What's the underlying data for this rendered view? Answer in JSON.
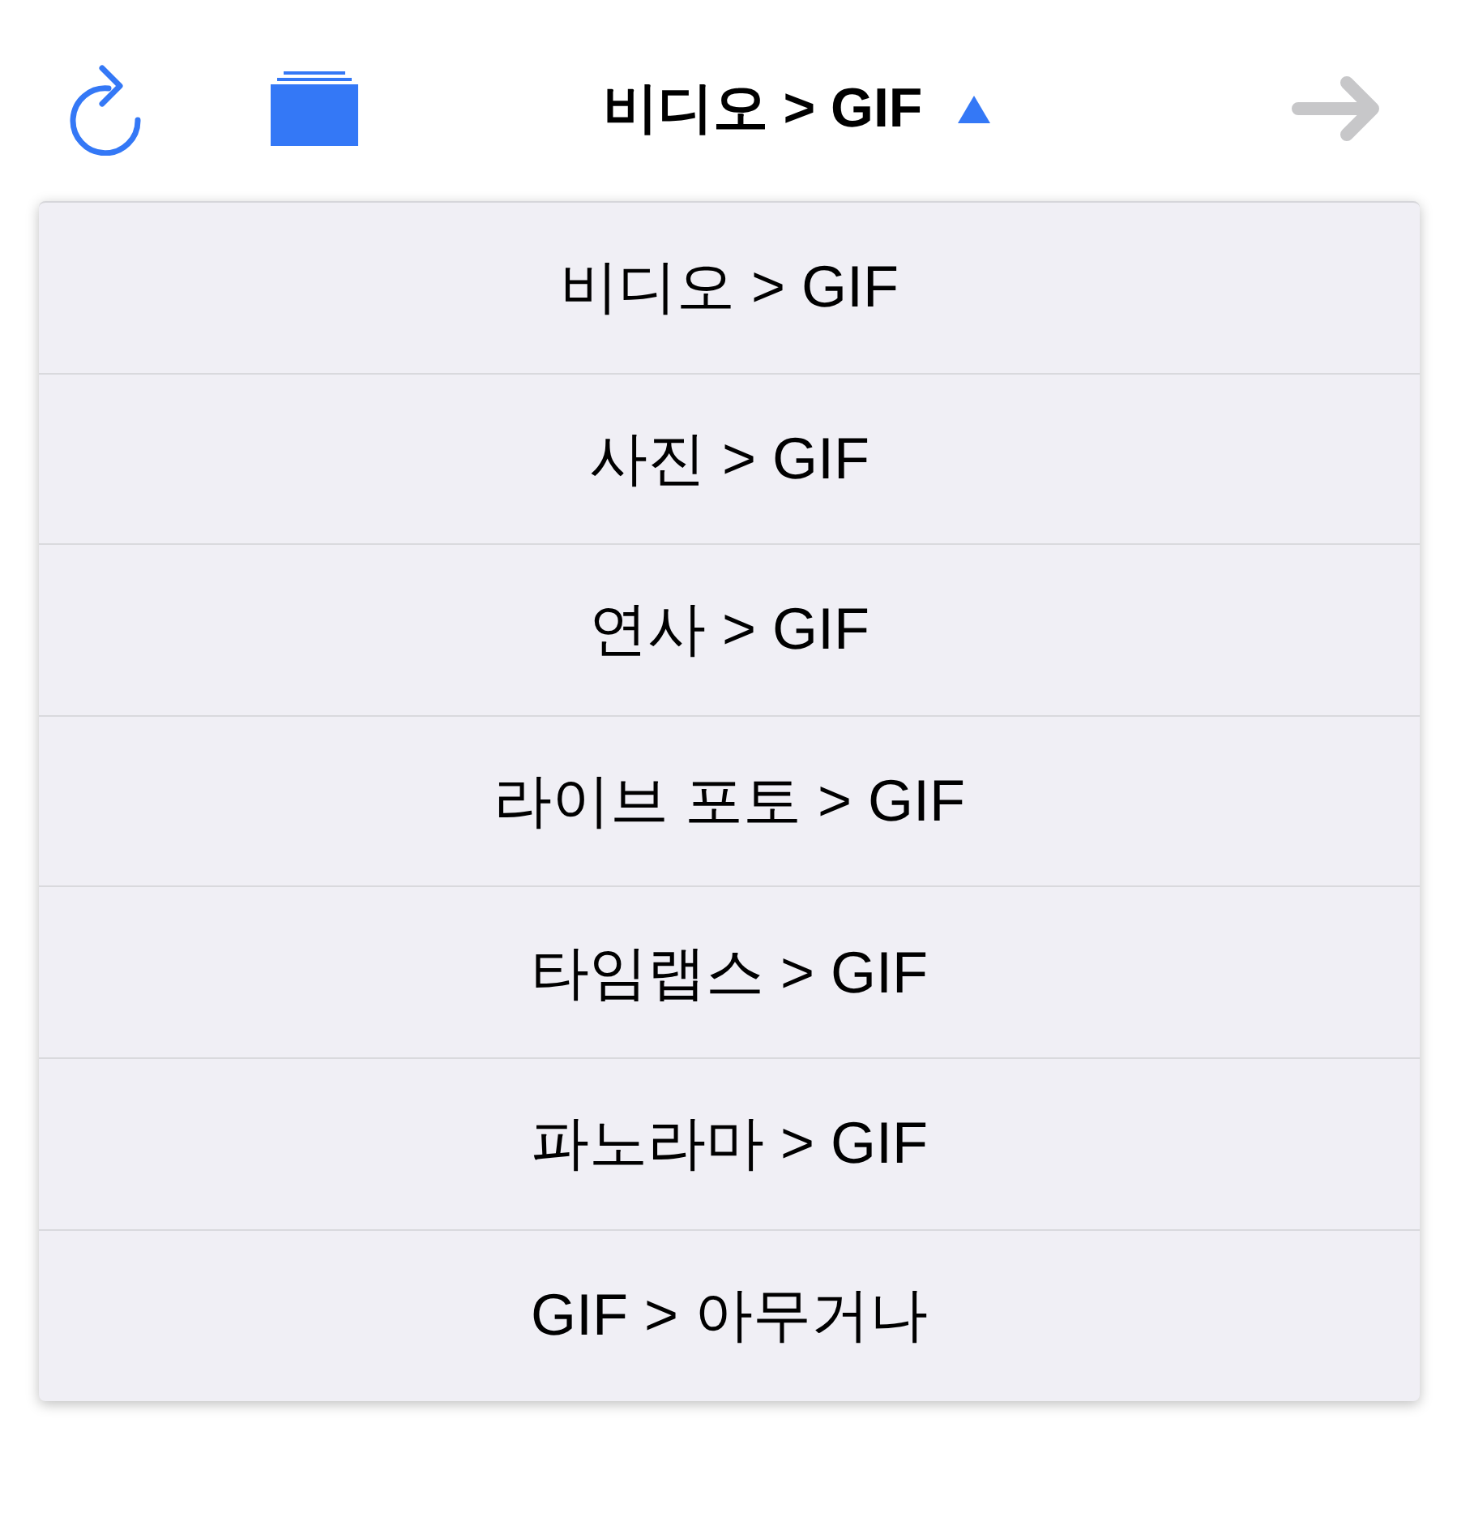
{
  "toolbar": {
    "title": "비디오 > GIF",
    "expanded": true,
    "next_disabled": true
  },
  "menu": {
    "items": [
      {
        "label": "비디오 > GIF"
      },
      {
        "label": "사진 > GIF"
      },
      {
        "label": "연사 > GIF"
      },
      {
        "label": "라이브 포토 > GIF"
      },
      {
        "label": "타임랩스 > GIF"
      },
      {
        "label": "파노라마 > GIF"
      },
      {
        "label": "GIF > 아무거나"
      }
    ]
  }
}
